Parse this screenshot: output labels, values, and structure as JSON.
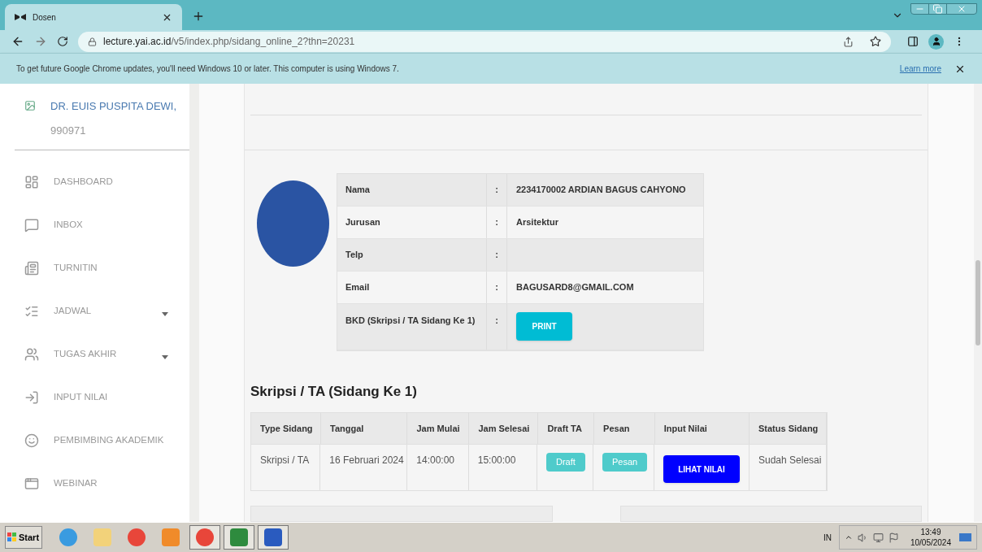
{
  "browser": {
    "tab_title": "Dosen",
    "url_host": "lecture.yai.ac.id",
    "url_path": "/v5/index.php/sidang_online_2?thn=20231"
  },
  "infobar": {
    "message": "To get future Google Chrome updates, you'll need Windows 10 or later. This computer is using Windows 7.",
    "link": "Learn more"
  },
  "sidebar": {
    "user_name": "DR. EUIS PUSPITA DEWI,",
    "user_id": "990971",
    "items": [
      {
        "label": "DASHBOARD",
        "kind": "dashboard",
        "has_submenu": false
      },
      {
        "label": "INBOX",
        "kind": "inbox",
        "has_submenu": false
      },
      {
        "label": "TURNITIN",
        "kind": "document",
        "has_submenu": false
      },
      {
        "label": "JADWAL",
        "kind": "list",
        "has_submenu": true
      },
      {
        "label": "TUGAS AKHIR",
        "kind": "people",
        "has_submenu": true
      },
      {
        "label": "INPUT NILAI",
        "kind": "input",
        "has_submenu": false
      },
      {
        "label": "PEMBIMBING AKADEMIK",
        "kind": "face",
        "has_submenu": false
      },
      {
        "label": "WEBINAR",
        "kind": "window",
        "has_submenu": false
      }
    ]
  },
  "profile": {
    "rows": [
      {
        "label": "Nama",
        "separator": ":",
        "value": "2234170002 ARDIAN BAGUS CAHYONO",
        "kind": "text"
      },
      {
        "label": "Jurusan",
        "separator": ":",
        "value": "Arsitektur",
        "kind": "text"
      },
      {
        "label": "Telp",
        "separator": ":",
        "kind": "text"
      },
      {
        "label": "Email",
        "separator": ":",
        "value": "BAGUSARD8@GMAIL.COM",
        "kind": "text"
      },
      {
        "label": "BKD (Skripsi / TA Sidang Ke 1)",
        "separator": ":",
        "value": "PRINT",
        "kind": "button"
      }
    ]
  },
  "schedule": {
    "title": "Skripsi / TA (Sidang Ke 1)",
    "columns": [
      "Type Sidang",
      "Tanggal",
      "Jam Mulai",
      "Jam Selesai",
      "Draft TA",
      "Pesan",
      "Input Nilai",
      "Status Sidang"
    ],
    "rows": [
      [
        {
          "kind": "text",
          "text": "Skripsi / TA"
        },
        {
          "kind": "text",
          "text": "16 Februari 2024"
        },
        {
          "kind": "text",
          "text": "14:00:00"
        },
        {
          "kind": "text",
          "text": "15:00:00"
        },
        {
          "kind": "small-button",
          "text": "Draft"
        },
        {
          "kind": "small-button",
          "text": "Pesan"
        },
        {
          "kind": "primary-button",
          "text": "LIHAT NILAI"
        },
        {
          "kind": "text",
          "text": "Sudah Selesai"
        }
      ]
    ]
  },
  "taskbar": {
    "start": "Start",
    "language": "IN",
    "time": "13:49",
    "date": "10/05/2024"
  }
}
